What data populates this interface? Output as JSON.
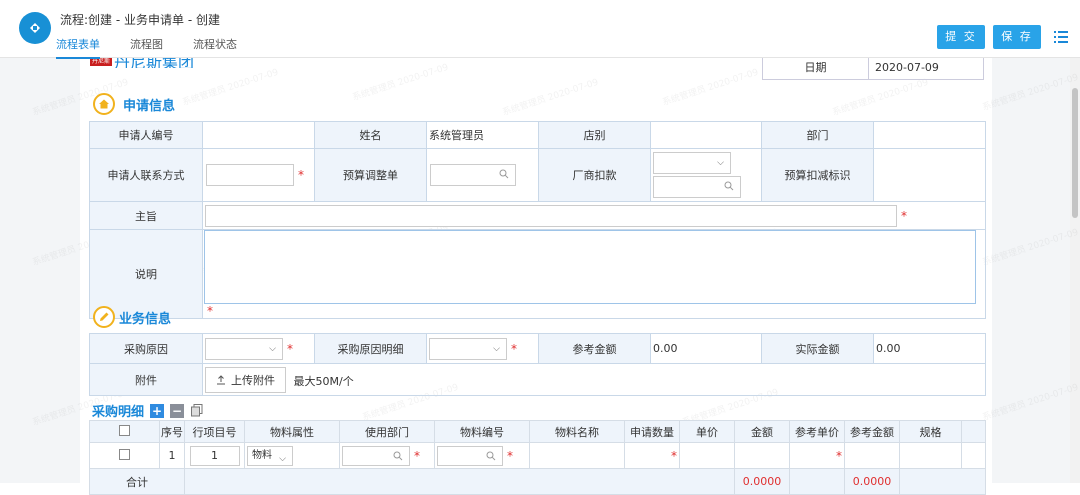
{
  "header": {
    "title": "流程:创建 - 业务申请单 - 创建",
    "tabs": [
      {
        "label": "流程表单"
      },
      {
        "label": "流程图"
      },
      {
        "label": "流程状态"
      }
    ],
    "submit_label": "提 交",
    "save_label": "保 存"
  },
  "brand": {
    "badge": "丹尼斯",
    "name": "丹尼斯集团"
  },
  "date": {
    "label": "日期",
    "value": "2020-07-09"
  },
  "apply_section": {
    "title": "申请信息",
    "applicant_no_label": "申请人编号",
    "name_label": "姓名",
    "name_value": "系统管理员",
    "store_label": "店别",
    "dept_label": "部门",
    "contact_label": "申请人联系方式",
    "budget_adjust_label": "预算调整单",
    "vendor_deduct_label": "厂商扣款",
    "budget_deduct_flag_label": "预算扣减标识",
    "subject_label": "主旨",
    "desc_label": "说明"
  },
  "business_section": {
    "title": "业务信息",
    "reason_label": "采购原因",
    "reason_detail_label": "采购原因明细",
    "ref_amount_label": "参考金额",
    "ref_amount_value": "0.00",
    "actual_amount_label": "实际金额",
    "actual_amount_value": "0.00",
    "attach_label": "附件",
    "upload_label": "上传附件",
    "max_size": "最大50M/个"
  },
  "detail": {
    "title": "采购明细",
    "columns": [
      "",
      "序号",
      "行项目号",
      "物料属性",
      "使用部门",
      "物料编号",
      "物料名称",
      "申请数量",
      "单价",
      "金额",
      "参考单价",
      "参考金额",
      "规格"
    ],
    "row": {
      "seq": "1",
      "line_no": "1",
      "material_attr": "物料"
    },
    "total_label": "合计",
    "total_amount": "0.0000",
    "total_ref_amount": "0.0000"
  },
  "watermark": "系统管理员 2020-07-09"
}
